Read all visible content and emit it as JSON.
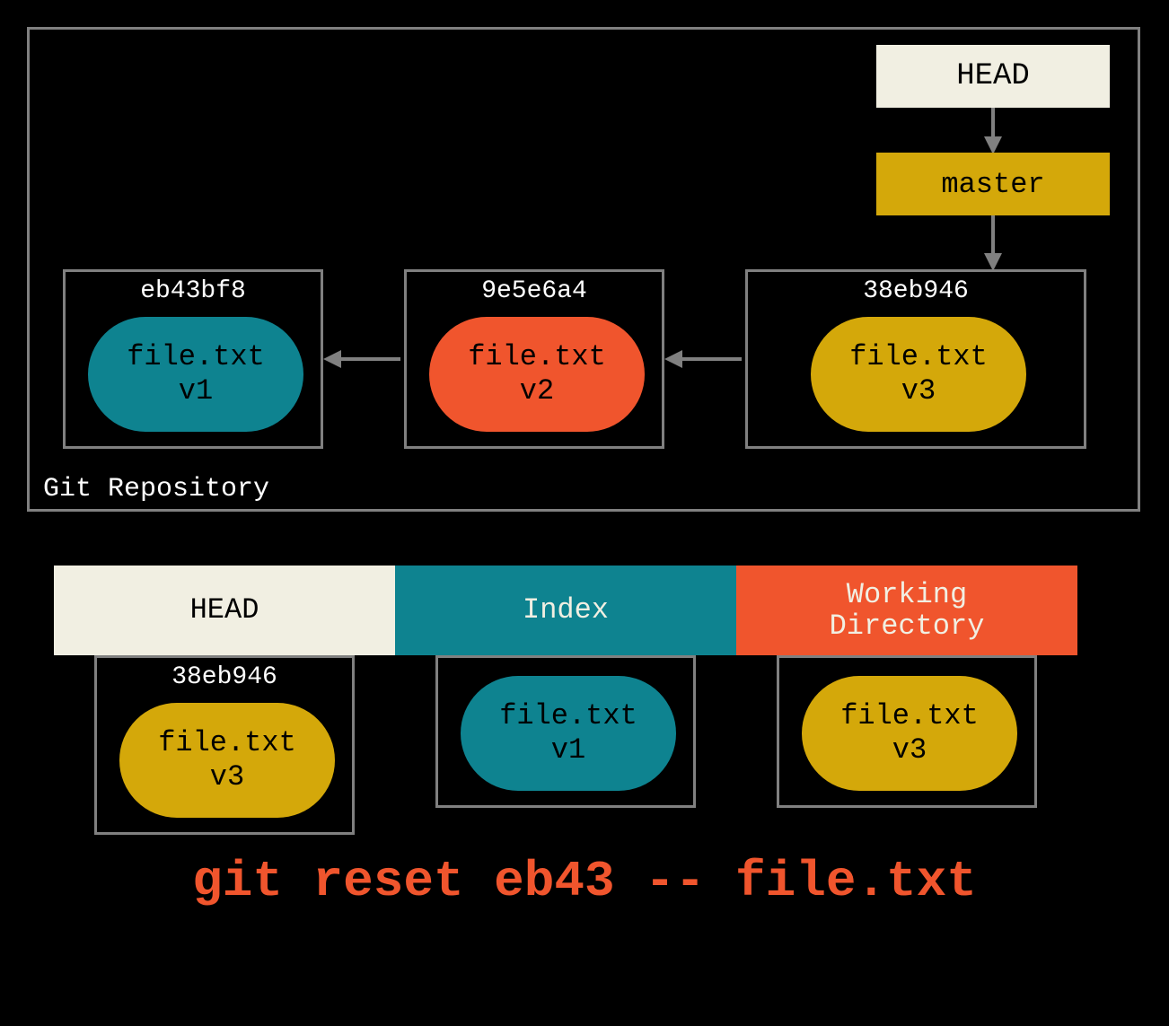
{
  "repo": {
    "label": "Git Repository",
    "head_label": "HEAD",
    "master_label": "master",
    "commits": [
      {
        "hash": "eb43bf8",
        "file": "file.txt",
        "version": "v1",
        "color": "teal"
      },
      {
        "hash": "9e5e6a4",
        "file": "file.txt",
        "version": "v2",
        "color": "orange"
      },
      {
        "hash": "38eb946",
        "file": "file.txt",
        "version": "v3",
        "color": "gold"
      }
    ]
  },
  "columns": {
    "head": {
      "label": "HEAD",
      "hash": "38eb946",
      "file": "file.txt",
      "version": "v3",
      "color": "gold"
    },
    "index": {
      "label": "Index",
      "file": "file.txt",
      "version": "v1",
      "color": "teal"
    },
    "working": {
      "label_line1": "Working",
      "label_line2": "Directory",
      "file": "file.txt",
      "version": "v3",
      "color": "gold"
    }
  },
  "command": "git reset eb43 -- file.txt",
  "chart_data": {
    "type": "diagram",
    "description": "Git reset file diagram showing HEAD -> master -> commit chain, and three trees (HEAD, Index, Working Directory) after running git reset eb43 -- file.txt",
    "commits": [
      {
        "hash": "eb43bf8",
        "content": "file.txt v1"
      },
      {
        "hash": "9e5e6a4",
        "content": "file.txt v2"
      },
      {
        "hash": "38eb946",
        "content": "file.txt v3"
      }
    ],
    "refs": {
      "HEAD": "master",
      "master": "38eb946"
    },
    "trees": {
      "HEAD": {
        "ref": "38eb946",
        "file.txt": "v3"
      },
      "Index": {
        "file.txt": "v1"
      },
      "WorkingDirectory": {
        "file.txt": "v3"
      }
    },
    "command": "git reset eb43 -- file.txt"
  }
}
